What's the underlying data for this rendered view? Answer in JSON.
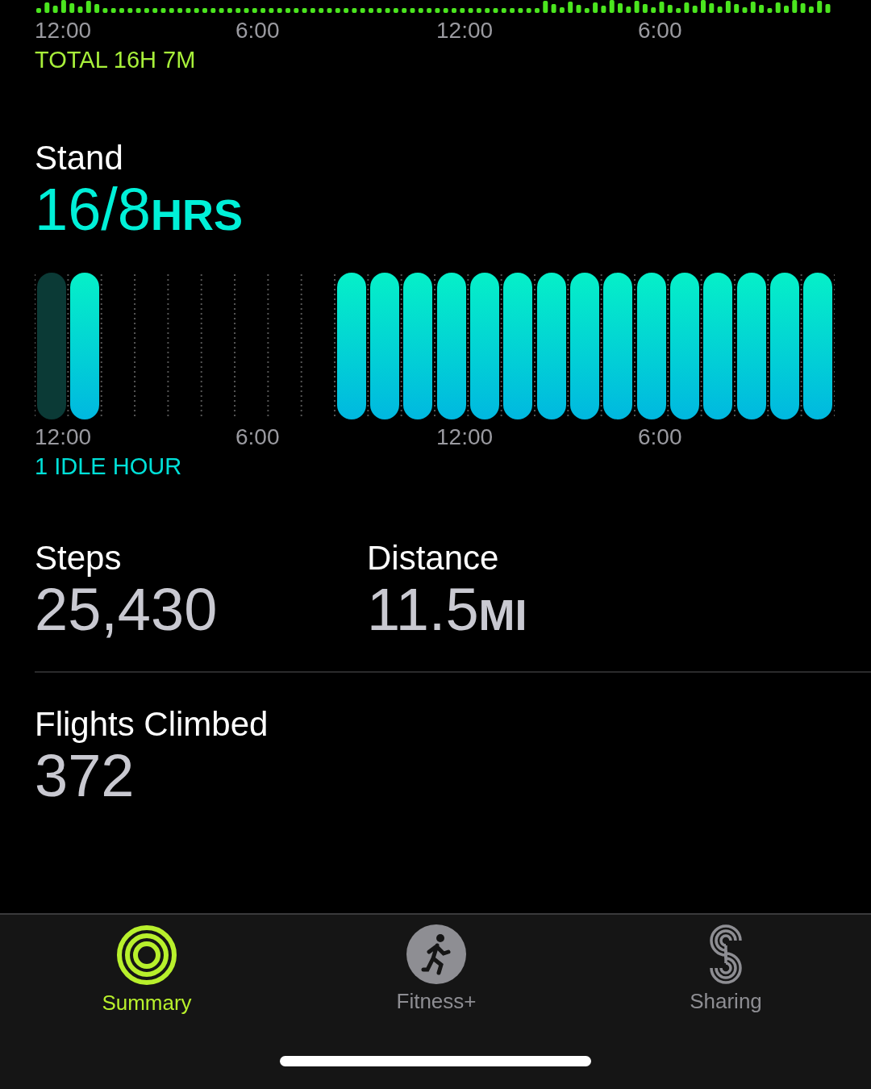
{
  "exercise": {
    "time_labels": [
      "12:00",
      "6:00",
      "12:00",
      "6:00"
    ],
    "total": "TOTAL 16H 7M"
  },
  "stand": {
    "title": "Stand",
    "value": "16/8",
    "unit": "HRS",
    "hours": [
      {
        "kind": "idle"
      },
      {
        "kind": "stood"
      },
      {
        "kind": "none"
      },
      {
        "kind": "none"
      },
      {
        "kind": "none"
      },
      {
        "kind": "none"
      },
      {
        "kind": "none"
      },
      {
        "kind": "none"
      },
      {
        "kind": "none"
      },
      {
        "kind": "stood"
      },
      {
        "kind": "stood"
      },
      {
        "kind": "stood"
      },
      {
        "kind": "stood"
      },
      {
        "kind": "stood"
      },
      {
        "kind": "stood"
      },
      {
        "kind": "stood"
      },
      {
        "kind": "stood"
      },
      {
        "kind": "stood"
      },
      {
        "kind": "stood"
      },
      {
        "kind": "stood"
      },
      {
        "kind": "stood"
      },
      {
        "kind": "stood"
      },
      {
        "kind": "stood"
      },
      {
        "kind": "stood"
      }
    ],
    "time_labels": [
      "12:00",
      "6:00",
      "12:00",
      "6:00"
    ],
    "summary": "1 IDLE HOUR"
  },
  "steps": {
    "title": "Steps",
    "value": "25,430"
  },
  "distance": {
    "title": "Distance",
    "value": "11.5",
    "unit": "MI"
  },
  "flights": {
    "title": "Flights Climbed",
    "value": "372"
  },
  "tabs": [
    {
      "label": "Summary",
      "selected": true,
      "kind": "rings"
    },
    {
      "label": "Fitness+",
      "selected": false,
      "kind": "runner"
    },
    {
      "label": "Sharing",
      "selected": false,
      "kind": "sharing"
    }
  ]
}
